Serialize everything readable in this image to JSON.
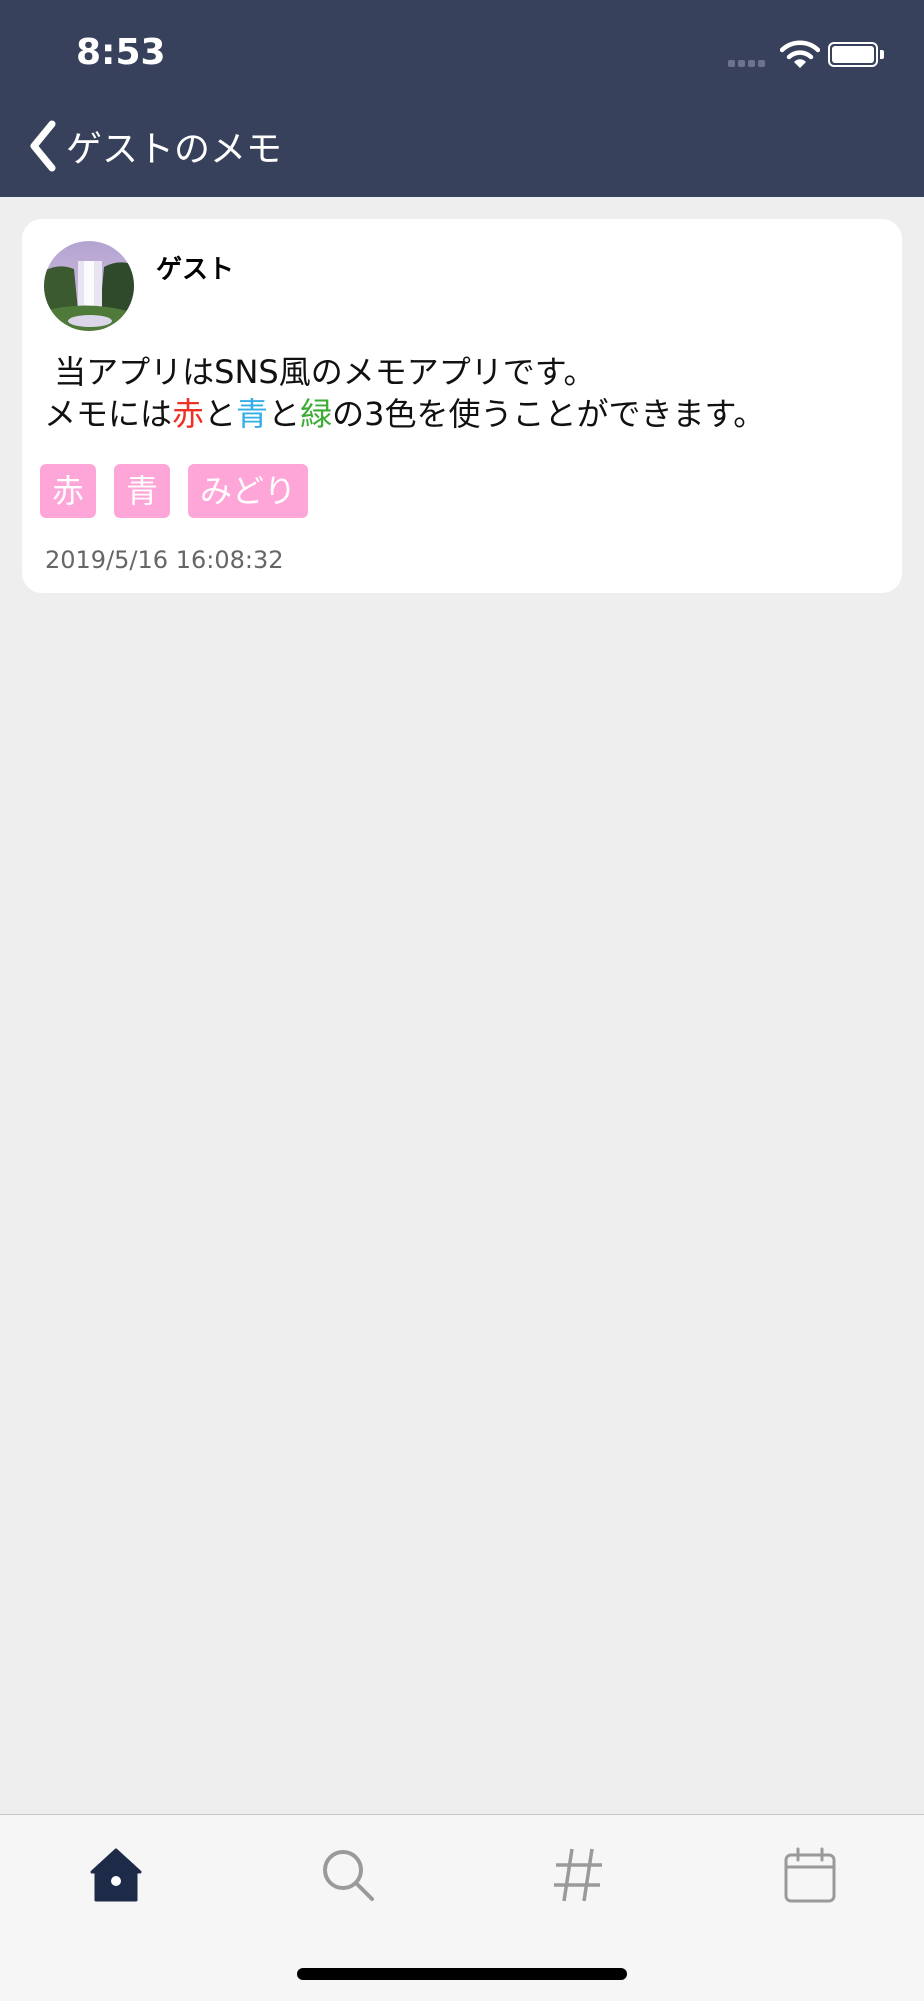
{
  "status_bar": {
    "time": "8:53"
  },
  "nav": {
    "title": "ゲストのメモ"
  },
  "memo": {
    "author": "ゲスト",
    "line1": " 当アプリはSNS風のメモアプリです。",
    "line2_parts": [
      "メモには",
      "赤",
      "と",
      "青",
      "と",
      "緑",
      "の3色を使うことができます。"
    ],
    "tags": [
      "赤",
      "青",
      "みどり"
    ],
    "timestamp": "2019/5/16 16:08:32"
  },
  "colors": {
    "header": "#38415c",
    "red_text": "#ee3124",
    "blue_text": "#35aee6",
    "green_text": "#3cac34",
    "tag_bg": "#ffa6d8",
    "active_tab": "#1d2a48",
    "inactive_tab": "#9a9a9a"
  },
  "tabbar": {
    "items": [
      "home-icon",
      "search-icon",
      "hashtag-icon",
      "calendar-icon"
    ],
    "active": "home-icon"
  }
}
